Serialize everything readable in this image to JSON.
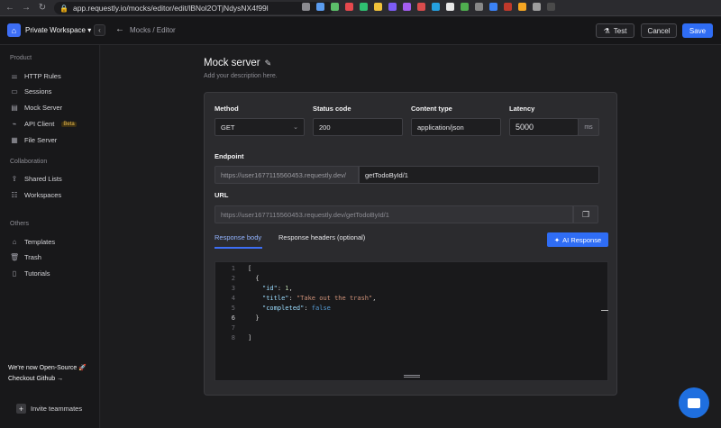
{
  "browser": {
    "url": "app.requestly.io/mocks/editor/edit/lBNol2OTjNdysNX4f99l",
    "extension_colors": [
      "#8b8b90",
      "#5a9cf0",
      "#5cc06a",
      "#e5484d",
      "#2fbf71",
      "#f0c23a",
      "#7c5cf5",
      "#a45df0",
      "#d94c4c",
      "#25a0e0",
      "#e8e8e8",
      "#4fae4f",
      "#888888",
      "#3b82f6",
      "#c0392b",
      "#f5a623",
      "#9e9e9e",
      "#4a4a4a"
    ]
  },
  "header": {
    "workspace_name": "Private Workspace",
    "workspace_caret": "▾",
    "breadcrumb": "Mocks / Editor",
    "test_label": "Test",
    "cancel_label": "Cancel",
    "save_label": "Save"
  },
  "sidebar": {
    "product_title": "Product",
    "product_items": [
      {
        "label": "HTTP Rules",
        "icon": "rules-icon"
      },
      {
        "label": "Sessions",
        "icon": "video-icon"
      },
      {
        "label": "Mock Server",
        "icon": "server-icon"
      },
      {
        "label": "API Client",
        "icon": "api-icon",
        "badge": "Beta"
      },
      {
        "label": "File Server",
        "icon": "file-icon"
      }
    ],
    "collab_title": "Collaboration",
    "collab_items": [
      {
        "label": "Shared Lists",
        "icon": "share-icon"
      },
      {
        "label": "Workspaces",
        "icon": "workspace-icon"
      }
    ],
    "others_title": "Others",
    "others_items": [
      {
        "label": "Templates",
        "icon": "template-icon"
      },
      {
        "label": "Trash",
        "icon": "trash-icon"
      },
      {
        "label": "Tutorials",
        "icon": "book-icon"
      }
    ],
    "open_source_text": "We're now Open-Source 🚀",
    "checkout_text": "Checkout Github →",
    "invite_label": "Invite teammates"
  },
  "editor_page": {
    "title": "Mock server",
    "description_placeholder": "Add your description here.",
    "method_label": "Method",
    "method_value": "GET",
    "status_label": "Status code",
    "status_value": "200",
    "content_type_label": "Content type",
    "content_type_value": "application/json",
    "latency_label": "Latency",
    "latency_value": "5000",
    "latency_unit": "ms",
    "endpoint_label": "Endpoint",
    "endpoint_prefix": "https://user1677115560453.requestly.dev/",
    "endpoint_value": "getTodoById/1",
    "url_label": "URL",
    "url_value": "https://user1677115560453.requestly.dev/getTodoById/1",
    "tab_response_body": "Response body",
    "tab_response_headers": "Response headers (optional)",
    "ai_button": "AI Response"
  },
  "code": {
    "line_numbers": [
      "1",
      "2",
      "3",
      "4",
      "5",
      "6",
      "7",
      "8"
    ],
    "l1": "[",
    "l2": "  {",
    "l3_key": "\"id\"",
    "l3_colon": ": ",
    "l3_val": "1",
    "l3_comma": ",",
    "l4_key": "\"title\"",
    "l4_colon": ": ",
    "l4_val": "\"Take out the trash\"",
    "l4_comma": ",",
    "l5_key": "\"completed\"",
    "l5_colon": ": ",
    "l5_val": "false",
    "l6": "  }",
    "l8": "]"
  }
}
